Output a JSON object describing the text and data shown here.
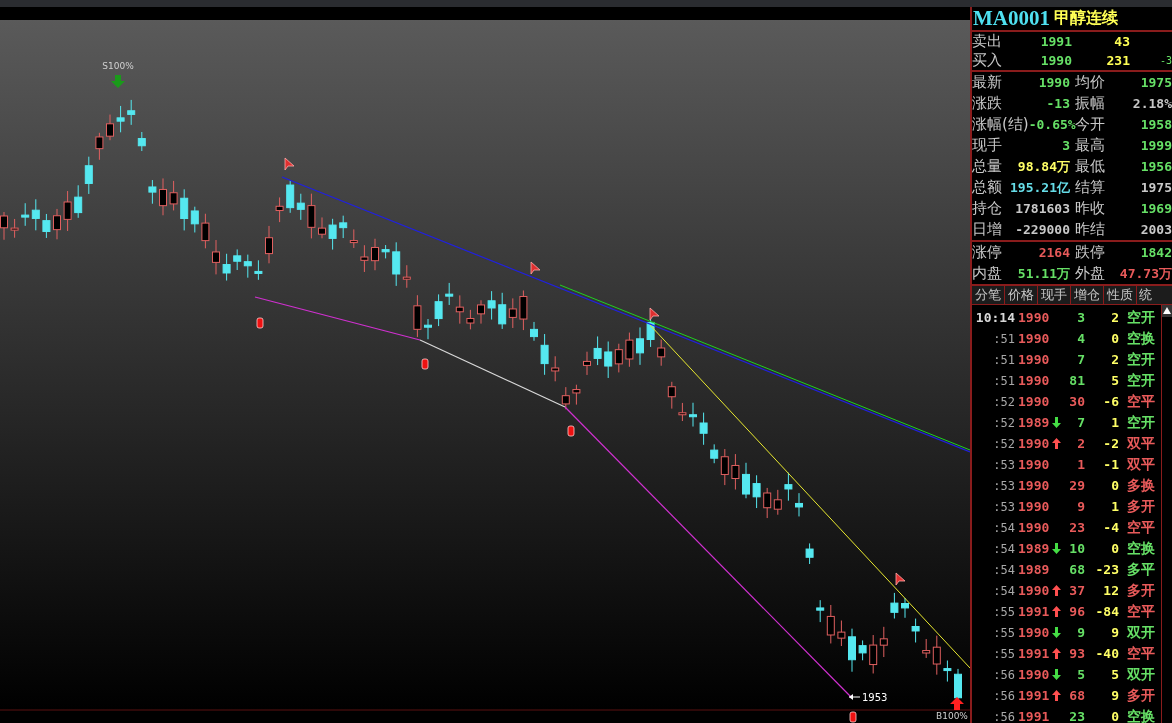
{
  "chart": {
    "sell_label": "S100%",
    "low_label": "1953",
    "buy_label": "B100%"
  },
  "title": {
    "code": "MA0001",
    "name": "甲醇连续"
  },
  "book": [
    {
      "label": "卖出",
      "price": "1991",
      "volume": "43"
    },
    {
      "label": "买入",
      "price": "1990",
      "volume": "231",
      "extra": "-3"
    }
  ],
  "quotes": [
    {
      "cells": [
        {
          "label": "最新",
          "value": "1990",
          "color": "#66e066"
        },
        {
          "label": "均价",
          "value": "1975",
          "color": "#66e066"
        }
      ]
    },
    {
      "cells": [
        {
          "label": "涨跌",
          "value": "-13",
          "color": "#66e066"
        },
        {
          "label": "振幅",
          "value": "2.18%",
          "color": "#c8c8c8"
        }
      ]
    },
    {
      "cells": [
        {
          "label": "涨幅(结)",
          "value": "-0.65%",
          "color": "#66e066"
        },
        {
          "label": "今开",
          "value": "1958",
          "color": "#66e066"
        }
      ]
    },
    {
      "cells": [
        {
          "label": "现手",
          "value": "3",
          "color": "#66e066"
        },
        {
          "label": "最高",
          "value": "1999",
          "color": "#66e066"
        }
      ]
    },
    {
      "cells": [
        {
          "label": "总量",
          "value": "98.84万",
          "color": "#ffff66"
        },
        {
          "label": "最低",
          "value": "1956",
          "color": "#66e066"
        }
      ]
    },
    {
      "cells": [
        {
          "label": "总额",
          "value": "195.21亿",
          "color": "#66dde8"
        },
        {
          "label": "结算",
          "value": "1975",
          "color": "#c8c8c8"
        }
      ]
    },
    {
      "cells": [
        {
          "label": "持仓",
          "value": "1781603",
          "color": "#c8c8c8"
        },
        {
          "label": "昨收",
          "value": "1969",
          "color": "#66e066"
        }
      ]
    },
    {
      "cells": [
        {
          "label": "日增",
          "value": "-229000",
          "color": "#c8c8c8"
        },
        {
          "label": "昨结",
          "value": "2003",
          "color": "#c8c8c8"
        }
      ]
    }
  ],
  "limits": [
    {
      "cells": [
        {
          "label": "涨停",
          "value": "2164",
          "color": "#e85a5a"
        },
        {
          "label": "跌停",
          "value": "1842",
          "color": "#66e066"
        }
      ]
    },
    {
      "cells": [
        {
          "label": "内盘",
          "value": "51.11万",
          "color": "#66e066"
        },
        {
          "label": "外盘",
          "value": "47.73万",
          "color": "#e85a5a"
        }
      ]
    }
  ],
  "columns": [
    "分笔",
    "价格",
    "现手",
    "增仓",
    "性质",
    "统"
  ],
  "trades": [
    {
      "time": "10:14",
      "price": "1990",
      "rising": false,
      "falling": false,
      "volume": {
        "text": "3",
        "color": "#66e066"
      },
      "change": "2",
      "nature": {
        "text": "空开",
        "color": "#66e066"
      }
    },
    {
      "time": ":51",
      "price": "1990",
      "rising": false,
      "falling": false,
      "volume": {
        "text": "4",
        "color": "#66e066"
      },
      "change": "0",
      "nature": {
        "text": "空换",
        "color": "#66e066"
      }
    },
    {
      "time": ":51",
      "price": "1990",
      "rising": false,
      "falling": false,
      "volume": {
        "text": "7",
        "color": "#66e066"
      },
      "change": "2",
      "nature": {
        "text": "空开",
        "color": "#66e066"
      }
    },
    {
      "time": ":51",
      "price": "1990",
      "rising": false,
      "falling": false,
      "volume": {
        "text": "81",
        "color": "#66e066"
      },
      "change": "5",
      "nature": {
        "text": "空开",
        "color": "#66e066"
      }
    },
    {
      "time": ":52",
      "price": "1990",
      "rising": false,
      "falling": false,
      "volume": {
        "text": "30",
        "color": "#e85a5a"
      },
      "change": "-6",
      "nature": {
        "text": "空平",
        "color": "#e85a5a"
      }
    },
    {
      "time": ":52",
      "price": "1989",
      "rising": false,
      "falling": true,
      "volume": {
        "text": "7",
        "color": "#66e066"
      },
      "change": "1",
      "nature": {
        "text": "空开",
        "color": "#66e066"
      }
    },
    {
      "time": ":52",
      "price": "1990",
      "rising": true,
      "falling": false,
      "volume": {
        "text": "2",
        "color": "#e85a5a"
      },
      "change": "-2",
      "nature": {
        "text": "双平",
        "color": "#e85a5a"
      }
    },
    {
      "time": ":53",
      "price": "1990",
      "rising": false,
      "falling": false,
      "volume": {
        "text": "1",
        "color": "#e85a5a"
      },
      "change": "-1",
      "nature": {
        "text": "双平",
        "color": "#e85a5a"
      }
    },
    {
      "time": ":53",
      "price": "1990",
      "rising": false,
      "falling": false,
      "volume": {
        "text": "29",
        "color": "#e85a5a"
      },
      "change": "0",
      "nature": {
        "text": "多换",
        "color": "#e85a5a"
      }
    },
    {
      "time": ":53",
      "price": "1990",
      "rising": false,
      "falling": false,
      "volume": {
        "text": "9",
        "color": "#e85a5a"
      },
      "change": "1",
      "nature": {
        "text": "多开",
        "color": "#e85a5a"
      }
    },
    {
      "time": ":54",
      "price": "1990",
      "rising": false,
      "falling": false,
      "volume": {
        "text": "23",
        "color": "#e85a5a"
      },
      "change": "-4",
      "nature": {
        "text": "空平",
        "color": "#e85a5a"
      }
    },
    {
      "time": ":54",
      "price": "1989",
      "rising": false,
      "falling": true,
      "volume": {
        "text": "10",
        "color": "#66e066"
      },
      "change": "0",
      "nature": {
        "text": "空换",
        "color": "#66e066"
      }
    },
    {
      "time": ":54",
      "price": "1989",
      "rising": false,
      "falling": false,
      "volume": {
        "text": "68",
        "color": "#66e066"
      },
      "change": "-23",
      "nature": {
        "text": "多平",
        "color": "#66e066"
      }
    },
    {
      "time": ":54",
      "price": "1990",
      "rising": true,
      "falling": false,
      "volume": {
        "text": "37",
        "color": "#e85a5a"
      },
      "change": "12",
      "nature": {
        "text": "多开",
        "color": "#e85a5a"
      }
    },
    {
      "time": ":55",
      "price": "1991",
      "rising": true,
      "falling": false,
      "volume": {
        "text": "96",
        "color": "#e85a5a"
      },
      "change": "-84",
      "nature": {
        "text": "空平",
        "color": "#e85a5a"
      }
    },
    {
      "time": ":55",
      "price": "1990",
      "rising": false,
      "falling": true,
      "volume": {
        "text": "9",
        "color": "#66e066"
      },
      "change": "9",
      "nature": {
        "text": "双开",
        "color": "#66e066"
      }
    },
    {
      "time": ":55",
      "price": "1991",
      "rising": true,
      "falling": false,
      "volume": {
        "text": "93",
        "color": "#e85a5a"
      },
      "change": "-40",
      "nature": {
        "text": "空平",
        "color": "#e85a5a"
      }
    },
    {
      "time": ":56",
      "price": "1990",
      "rising": false,
      "falling": true,
      "volume": {
        "text": "5",
        "color": "#66e066"
      },
      "change": "5",
      "nature": {
        "text": "双开",
        "color": "#66e066"
      }
    },
    {
      "time": ":56",
      "price": "1991",
      "rising": true,
      "falling": false,
      "volume": {
        "text": "68",
        "color": "#e85a5a"
      },
      "change": "9",
      "nature": {
        "text": "多开",
        "color": "#e85a5a"
      }
    },
    {
      "time": ":56",
      "price": "1991",
      "rising": false,
      "falling": false,
      "volume": {
        "text": "23",
        "color": "#66e066"
      },
      "change": "0",
      "nature": {
        "text": "空换",
        "color": "#66e066"
      }
    }
  ]
}
